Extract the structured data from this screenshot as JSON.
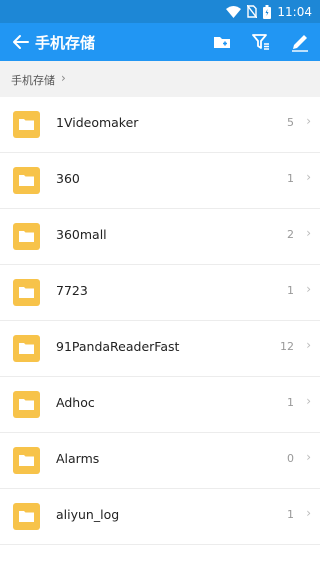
{
  "status_bar": {
    "time": "11:04",
    "icons": [
      "wifi-icon",
      "no-sim-icon",
      "battery-icon"
    ]
  },
  "app_bar": {
    "title": "手机存储",
    "actions": [
      "new-folder-icon",
      "filter-icon",
      "edit-icon"
    ],
    "color": "#2196f3"
  },
  "breadcrumb": {
    "label": "手机存储",
    "separator": "›"
  },
  "folders": [
    {
      "name": "1Videomaker",
      "count": "5"
    },
    {
      "name": "360",
      "count": "1"
    },
    {
      "name": "360mall",
      "count": "2"
    },
    {
      "name": "7723",
      "count": "1"
    },
    {
      "name": "91PandaReaderFast",
      "count": "12"
    },
    {
      "name": "Adhoc",
      "count": "1"
    },
    {
      "name": "Alarms",
      "count": "0"
    },
    {
      "name": "aliyun_log",
      "count": "1"
    }
  ],
  "folder_color": "#f7c34a"
}
